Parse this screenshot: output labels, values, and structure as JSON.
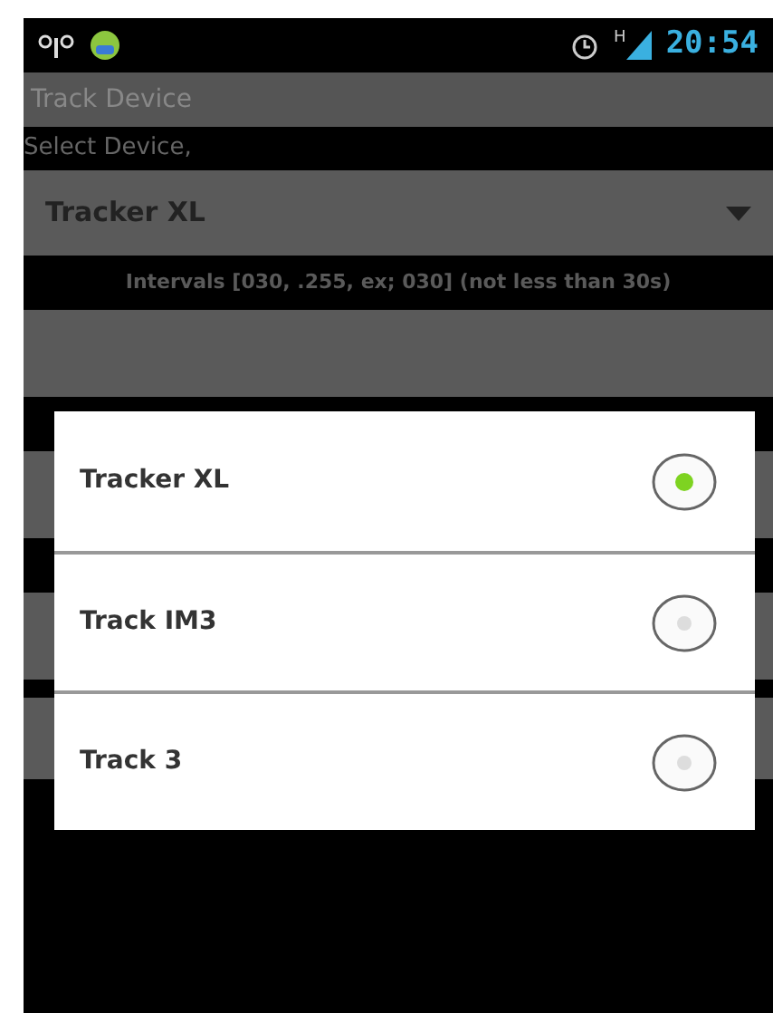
{
  "status_bar": {
    "network_type": "H",
    "time": "20:54"
  },
  "title_bar": {
    "title": "Track Device"
  },
  "select_label": "Select Device,",
  "spinner": {
    "value": "Tracker XL"
  },
  "intervals_hint": "Intervals [030, .255, ex; 030] (not less than 30s)",
  "dialog": {
    "options": [
      {
        "label": "Tracker XL",
        "selected": true
      },
      {
        "label": "Track IM3",
        "selected": false
      },
      {
        "label": "Track 3",
        "selected": false
      }
    ]
  }
}
